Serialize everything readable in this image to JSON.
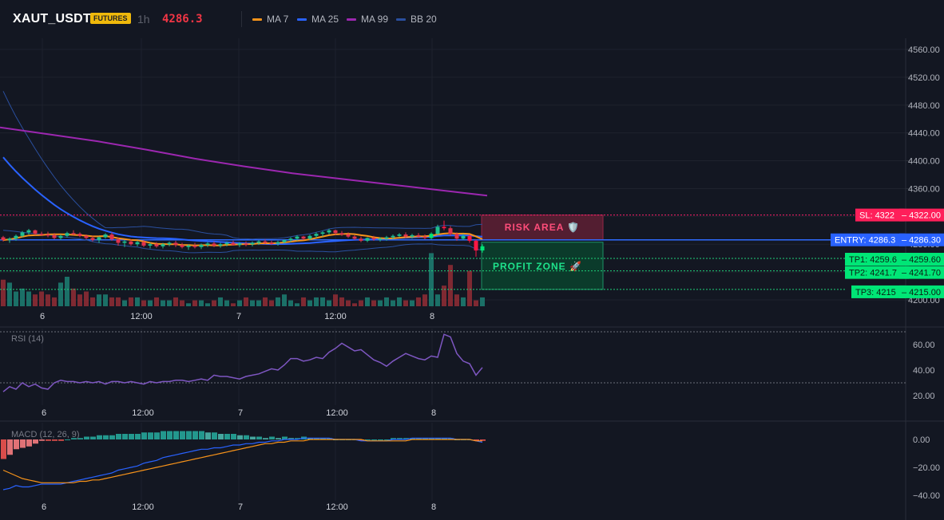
{
  "header": {
    "symbol": "XAUT_USDT",
    "badge": "FUTURES",
    "timeframe": "1h",
    "price": "4286.3",
    "legend": [
      {
        "label": "MA 7",
        "color": "#f7931a"
      },
      {
        "label": "MA 25",
        "color": "#2962ff"
      },
      {
        "label": "MA 99",
        "color": "#9c27b0"
      },
      {
        "label": "BB 20",
        "color": "#2a4f9e"
      }
    ]
  },
  "colors": {
    "up": "#26a69a",
    "down": "#ef5350",
    "bright_up": "#00e676",
    "bright_down": "#ff1744",
    "background": "#131722"
  },
  "levels": {
    "sl": {
      "label": "SL: 4322",
      "value_text": "4322.00",
      "value": 4322
    },
    "entry": {
      "label": "ENTRY: 4286.3",
      "value_text": "4286.30",
      "value": 4286.3
    },
    "tp1": {
      "label": "TP1: 4259.6",
      "value_text": "4259.60",
      "value": 4259.6
    },
    "tp2": {
      "label": "TP2: 4241.7",
      "value_text": "4241.70",
      "value": 4241.7
    },
    "tp3": {
      "label": "TP3: 4215",
      "value_text": "4215.00",
      "value": 4215
    }
  },
  "zones": {
    "risk": "RISK AREA 🛡️",
    "profit": "PROFIT ZONE 🚀"
  },
  "x_ticks": [
    "6",
    "12:00",
    "7",
    "12:00",
    "8"
  ],
  "rsi_label": "RSI (14)",
  "macd_label": "MACD (12, 26, 9)",
  "chart_data": [
    {
      "type": "candlestick",
      "axis": {
        "ylim": [
          4190,
          4575
        ],
        "ticks": [
          "4560.00",
          "4520.00",
          "4480.00",
          "4440.00",
          "4400.00",
          "4360.00",
          "4320.00",
          "4280.00",
          "4240.00",
          "4200.00"
        ]
      },
      "series": [
        {
          "name": "MA 7"
        },
        {
          "name": "MA 25"
        },
        {
          "name": "MA 99",
          "x": [
            0,
            10,
            20,
            30,
            40,
            50,
            60,
            70,
            80,
            90,
            100
          ],
          "values": [
            4448,
            4438,
            4428,
            4416,
            4403,
            4392,
            4382,
            4374,
            4366,
            4358,
            4350
          ]
        },
        {
          "name": "BB 20"
        }
      ],
      "candles": [
        [
          4290,
          4292,
          4284,
          4286
        ],
        [
          4286,
          4290,
          4282,
          4288
        ],
        [
          4288,
          4294,
          4285,
          4292
        ],
        [
          4292,
          4299,
          4290,
          4297
        ],
        [
          4297,
          4302,
          4294,
          4300
        ],
        [
          4300,
          4301,
          4293,
          4295
        ],
        [
          4295,
          4298,
          4292,
          4294
        ],
        [
          4294,
          4298,
          4290,
          4293
        ],
        [
          4293,
          4296,
          4287,
          4289
        ],
        [
          4289,
          4294,
          4286,
          4292
        ],
        [
          4292,
          4298,
          4290,
          4296
        ],
        [
          4296,
          4300,
          4293,
          4295
        ],
        [
          4295,
          4297,
          4290,
          4292
        ],
        [
          4292,
          4294,
          4287,
          4289
        ],
        [
          4289,
          4292,
          4284,
          4286
        ],
        [
          4286,
          4291,
          4282,
          4290
        ],
        [
          4290,
          4296,
          4288,
          4294
        ],
        [
          4294,
          4297,
          4285,
          4287
        ],
        [
          4287,
          4290,
          4278,
          4282
        ],
        [
          4282,
          4286,
          4276,
          4284
        ],
        [
          4284,
          4287,
          4278,
          4280
        ],
        [
          4280,
          4285,
          4277,
          4283
        ],
        [
          4283,
          4286,
          4276,
          4278
        ],
        [
          4278,
          4282,
          4274,
          4280
        ],
        [
          4280,
          4283,
          4275,
          4277
        ],
        [
          4277,
          4282,
          4274,
          4280
        ],
        [
          4280,
          4284,
          4277,
          4282
        ],
        [
          4282,
          4285,
          4276,
          4279
        ],
        [
          4279,
          4282,
          4274,
          4276
        ],
        [
          4276,
          4280,
          4272,
          4278
        ],
        [
          4278,
          4282,
          4274,
          4276
        ],
        [
          4276,
          4281,
          4273,
          4279
        ],
        [
          4279,
          4283,
          4276,
          4281
        ],
        [
          4281,
          4284,
          4276,
          4278
        ],
        [
          4278,
          4282,
          4275,
          4280
        ],
        [
          4280,
          4284,
          4277,
          4282
        ],
        [
          4282,
          4285,
          4278,
          4279
        ],
        [
          4279,
          4283,
          4276,
          4281
        ],
        [
          4281,
          4284,
          4277,
          4280
        ],
        [
          4280,
          4284,
          4277,
          4282
        ],
        [
          4282,
          4286,
          4279,
          4284
        ],
        [
          4284,
          4287,
          4280,
          4282
        ],
        [
          4282,
          4285,
          4279,
          4281
        ],
        [
          4281,
          4285,
          4278,
          4283
        ],
        [
          4283,
          4287,
          4281,
          4286
        ],
        [
          4286,
          4290,
          4283,
          4288
        ],
        [
          4288,
          4293,
          4285,
          4291
        ],
        [
          4291,
          4292,
          4286,
          4288
        ],
        [
          4288,
          4294,
          4286,
          4292
        ],
        [
          4292,
          4297,
          4289,
          4295
        ],
        [
          4295,
          4299,
          4291,
          4297
        ],
        [
          4297,
          4302,
          4294,
          4300
        ],
        [
          4300,
          4301,
          4293,
          4296
        ],
        [
          4296,
          4299,
          4292,
          4294
        ],
        [
          4294,
          4297,
          4289,
          4291
        ],
        [
          4291,
          4293,
          4286,
          4288
        ],
        [
          4288,
          4291,
          4283,
          4285
        ],
        [
          4285,
          4290,
          4283,
          4289
        ],
        [
          4289,
          4292,
          4285,
          4287
        ],
        [
          4287,
          4290,
          4284,
          4288
        ],
        [
          4288,
          4292,
          4285,
          4290
        ],
        [
          4290,
          4294,
          4287,
          4292
        ],
        [
          4292,
          4296,
          4290,
          4294
        ],
        [
          4294,
          4297,
          4289,
          4291
        ],
        [
          4291,
          4295,
          4288,
          4293
        ],
        [
          4293,
          4296,
          4289,
          4291
        ],
        [
          4291,
          4294,
          4287,
          4289
        ],
        [
          4289,
          4297,
          4287,
          4295
        ],
        [
          4295,
          4308,
          4293,
          4305
        ],
        [
          4305,
          4314,
          4300,
          4303
        ],
        [
          4303,
          4306,
          4292,
          4295
        ],
        [
          4295,
          4297,
          4285,
          4288
        ],
        [
          4288,
          4295,
          4286,
          4292
        ],
        [
          4292,
          4294,
          4282,
          4285
        ],
        [
          4285,
          4287,
          4262,
          4271
        ],
        [
          4271,
          4280,
          4268,
          4277
        ]
      ],
      "volumes": [
        9,
        8,
        5,
        6,
        5,
        4,
        5,
        4,
        3,
        8,
        10,
        6,
        4,
        5,
        3,
        4,
        4,
        3,
        3,
        2,
        3,
        3,
        2,
        2,
        3,
        2,
        2,
        3,
        2,
        1,
        2,
        2,
        1,
        2,
        3,
        2,
        1,
        2,
        3,
        2,
        2,
        3,
        2,
        3,
        4,
        2,
        1,
        3,
        2,
        3,
        3,
        2,
        4,
        3,
        2,
        1,
        2,
        3,
        2,
        2,
        3,
        2,
        3,
        2,
        2,
        3,
        4,
        18,
        4,
        7,
        14,
        4,
        3,
        12,
        2,
        3
      ],
      "x_tick_labels": [
        "6",
        "12:00",
        "7",
        "12:00",
        "8"
      ]
    },
    {
      "type": "line",
      "series": [
        {
          "name": "RSI (14)",
          "values": [
            23,
            27,
            25,
            30,
            27,
            29,
            26,
            25,
            30,
            32,
            31,
            31,
            30,
            31,
            30,
            31,
            29,
            31,
            31,
            30,
            31,
            30,
            29,
            31,
            30,
            31,
            31,
            32,
            32,
            31,
            32,
            33,
            32,
            36,
            35,
            35,
            34,
            33,
            35,
            36,
            37,
            39,
            41,
            40,
            44,
            49,
            49,
            47,
            48,
            50,
            49,
            54,
            57,
            61,
            58,
            55,
            56,
            52,
            48,
            46,
            43,
            47,
            50,
            53,
            51,
            49,
            48,
            51,
            50,
            68,
            66,
            53,
            47,
            45,
            36,
            42
          ]
        }
      ],
      "ylim": [
        15,
        72
      ],
      "ticks": [
        "60.00",
        "40.00",
        "20.00"
      ],
      "guide_lines": [
        70,
        30
      ]
    },
    {
      "type": "bar",
      "series": [
        {
          "name": "MACD",
          "values": [
            -36,
            -35,
            -33,
            -34,
            -34,
            -33,
            -32,
            -32,
            -32,
            -32,
            -31,
            -30,
            -29,
            -28,
            -27,
            -26,
            -25,
            -24,
            -22,
            -21,
            -20,
            -19,
            -17,
            -16,
            -15,
            -13,
            -12,
            -11,
            -10,
            -9,
            -8,
            -7,
            -7,
            -6,
            -6,
            -5,
            -4,
            -4,
            -3,
            -3,
            -2,
            -2,
            -1,
            -1,
            0,
            0,
            0,
            1,
            1,
            1,
            1,
            1,
            0,
            0,
            0,
            0,
            -1,
            -1,
            -1,
            -1,
            -1,
            0,
            0,
            0,
            1,
            1,
            1,
            1,
            1,
            1,
            1,
            0,
            0,
            0,
            -1,
            -2
          ]
        },
        {
          "name": "Signal",
          "values": [
            -22,
            -24,
            -26,
            -28,
            -29,
            -30,
            -31,
            -31,
            -31,
            -31,
            -31,
            -31,
            -30,
            -30,
            -29,
            -29,
            -28,
            -27,
            -26,
            -25,
            -24,
            -23,
            -22,
            -21,
            -20,
            -19,
            -18,
            -17,
            -16,
            -15,
            -14,
            -13,
            -12,
            -11,
            -10,
            -9,
            -8,
            -7,
            -6,
            -5,
            -4,
            -3,
            -3,
            -2,
            -2,
            -1,
            -1,
            -1,
            0,
            0,
            0,
            0,
            0,
            0,
            0,
            0,
            0,
            -1,
            -1,
            -1,
            -1,
            -1,
            -1,
            -1,
            0,
            0,
            0,
            0,
            0,
            0,
            0,
            0,
            0,
            0,
            -1,
            -1
          ]
        },
        {
          "name": "Histogram",
          "values": [
            -14,
            -11,
            -7,
            -6,
            -5,
            -3,
            -1,
            -1,
            -1,
            -1,
            0,
            1,
            1,
            2,
            2,
            3,
            3,
            3,
            4,
            4,
            4,
            4,
            5,
            5,
            5,
            6,
            6,
            6,
            6,
            6,
            6,
            6,
            5,
            5,
            4,
            4,
            4,
            3,
            3,
            2,
            2,
            1,
            2,
            1,
            2,
            1,
            1,
            2,
            1,
            1,
            1,
            1,
            0,
            0,
            0,
            0,
            -1,
            0,
            0,
            0,
            0,
            1,
            1,
            1,
            1,
            1,
            1,
            1,
            1,
            1,
            1,
            0,
            0,
            0,
            -1,
            -1
          ]
        }
      ],
      "ylim": [
        -45,
        6
      ],
      "ticks": [
        "0.00",
        "−20.00",
        "−40.00"
      ]
    }
  ]
}
